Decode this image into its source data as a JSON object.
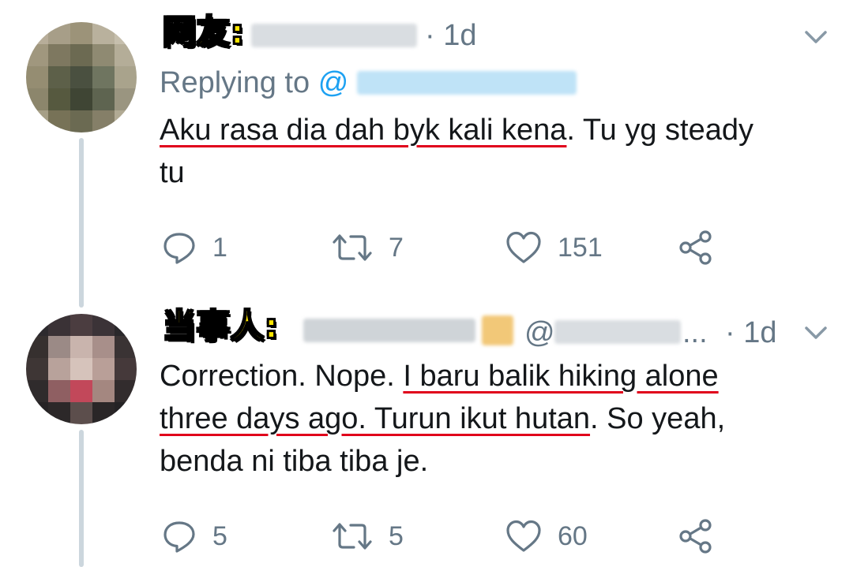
{
  "colors": {
    "accent": "#1da1f2",
    "secondary_text": "#657786",
    "underline": "#e0001b",
    "label_fill": "#ffe600",
    "thread_line": "#ccd6dd"
  },
  "tweets": [
    {
      "label": "网友:",
      "time": "· 1d",
      "replying_prefix": "Replying to",
      "mention_at": "@",
      "text_underlined": "Aku rasa dia dah byk kali kena",
      "text_rest_line1": ". Tu yg steady",
      "text_line2": "tu",
      "actions": {
        "replies": "1",
        "retweets": "7",
        "likes": "151"
      },
      "icons": [
        "reply-icon",
        "retweet-icon",
        "like-icon",
        "share-icon",
        "chevron-down-icon"
      ]
    },
    {
      "label": "当事人:",
      "handle_at": "@",
      "ellipsis": "...",
      "time": "· 1d",
      "text_line1_plain": "Correction. Nope. ",
      "text_line1_underlined": "I baru balik hiking alone",
      "text_line2_underlined": "three days ago. Turun ikut hutan",
      "text_line2_rest": ". So yeah,",
      "text_line3": "benda ni tiba tiba je.",
      "actions": {
        "replies": "5",
        "retweets": "5",
        "likes": "60"
      },
      "icons": [
        "reply-icon",
        "retweet-icon",
        "like-icon",
        "share-icon",
        "chevron-down-icon"
      ]
    }
  ]
}
